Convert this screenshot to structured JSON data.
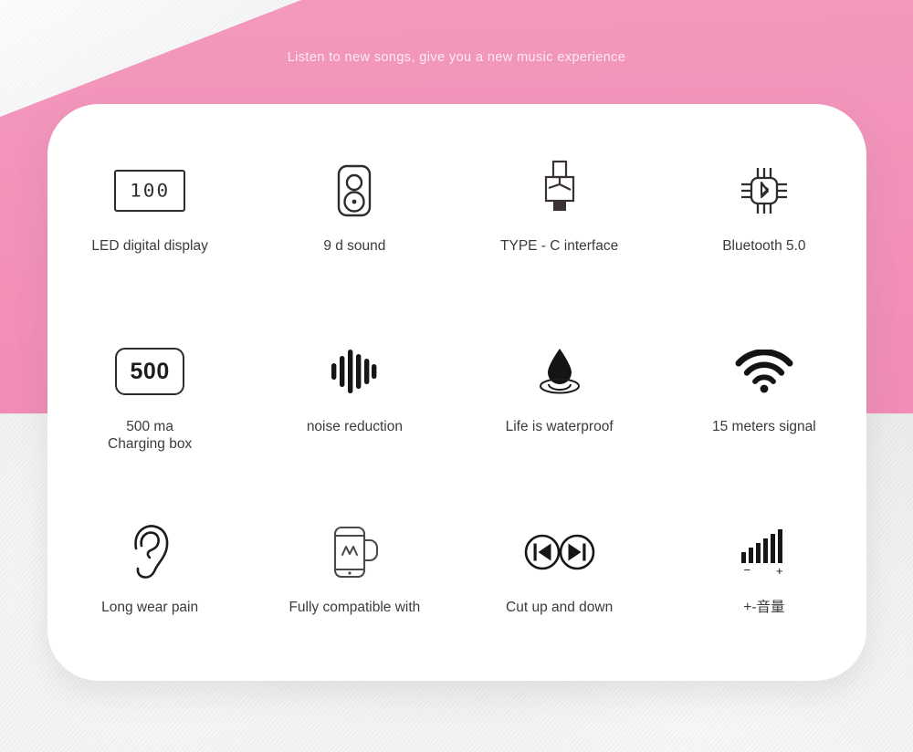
{
  "tagline": "Listen to new songs, give you a new music experience",
  "theme": {
    "pink": "#f294bb",
    "card_bg": "#ffffff",
    "text": "#3b3b3b",
    "icon": "#2d2d2d",
    "gray_bg": "#e6e6e6"
  },
  "features": [
    {
      "icon": "led-digital-display-icon",
      "icon_text": "100",
      "label": "LED digital display"
    },
    {
      "icon": "speaker-icon",
      "label": "9 d sound"
    },
    {
      "icon": "usb-type-c-connector-icon",
      "label": "TYPE - C interface"
    },
    {
      "icon": "bluetooth-chip-icon",
      "label": "Bluetooth 5.0"
    },
    {
      "icon": "charging-box-capacity-icon",
      "icon_text": "500",
      "label": "500 ma\nCharging box"
    },
    {
      "icon": "sound-wave-icon",
      "label": "noise reduction"
    },
    {
      "icon": "water-droplet-icon",
      "label": "Life is waterproof"
    },
    {
      "icon": "wifi-signal-icon",
      "label": "15 meters signal"
    },
    {
      "icon": "ear-icon",
      "label": "Long wear pain"
    },
    {
      "icon": "phone-compatible-icon",
      "label": "Fully compatible with"
    },
    {
      "icon": "track-prev-next-icon",
      "label": "Cut up and down"
    },
    {
      "icon": "volume-bars-icon",
      "volume_minus": "−",
      "volume_plus": "+",
      "label": "+-音量"
    }
  ]
}
